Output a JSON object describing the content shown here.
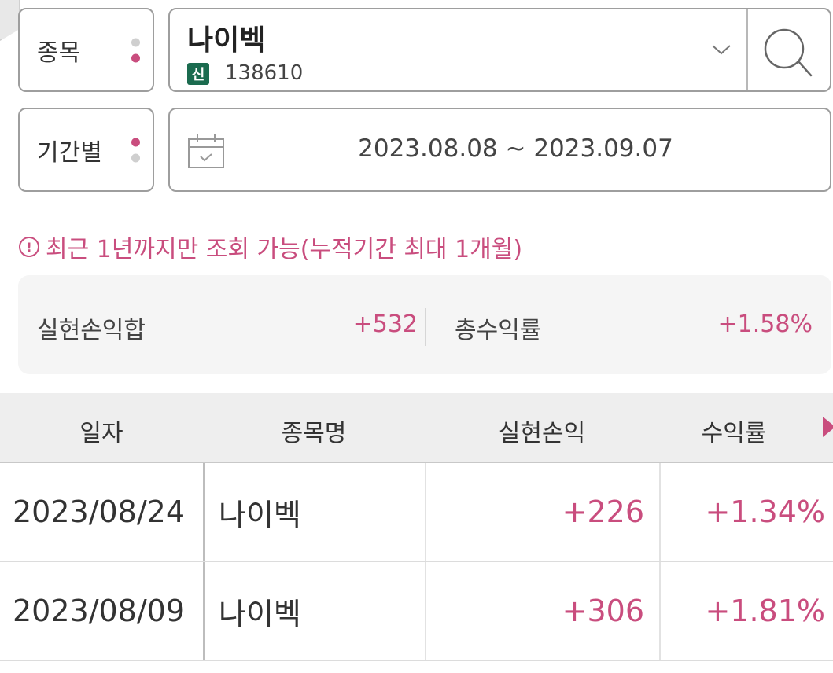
{
  "filters": {
    "stock_label": "종목",
    "period_label": "기간별",
    "stock_name": "나이벡",
    "stock_badge": "신",
    "stock_code": "138610",
    "date_range": "2023.08.08 ~ 2023.09.07"
  },
  "notice": {
    "icon_symbol": "!",
    "text": "최근 1년까지만 조회 가능(누적기간 최대 1개월)"
  },
  "summary": {
    "realized_pl_label": "실현손익합",
    "realized_pl_value": "+532",
    "total_return_label": "총수익률",
    "total_return_value": "+1.58%"
  },
  "table": {
    "headers": [
      "일자",
      "종목명",
      "실현손익",
      "수익률"
    ],
    "rows": [
      {
        "date": "2023/08/24",
        "name": "나이벡",
        "pl": "+226",
        "rate": "+1.34%"
      },
      {
        "date": "2023/08/09",
        "name": "나이벡",
        "pl": "+306",
        "rate": "+1.81%"
      }
    ]
  },
  "colors": {
    "accent": "#c94d7e",
    "badge": "#1b6b4f",
    "border": "#9e9e9e"
  },
  "icons": [
    "chevron-down-icon",
    "search-icon",
    "calendar-icon",
    "info-icon",
    "scroll-right-icon"
  ]
}
